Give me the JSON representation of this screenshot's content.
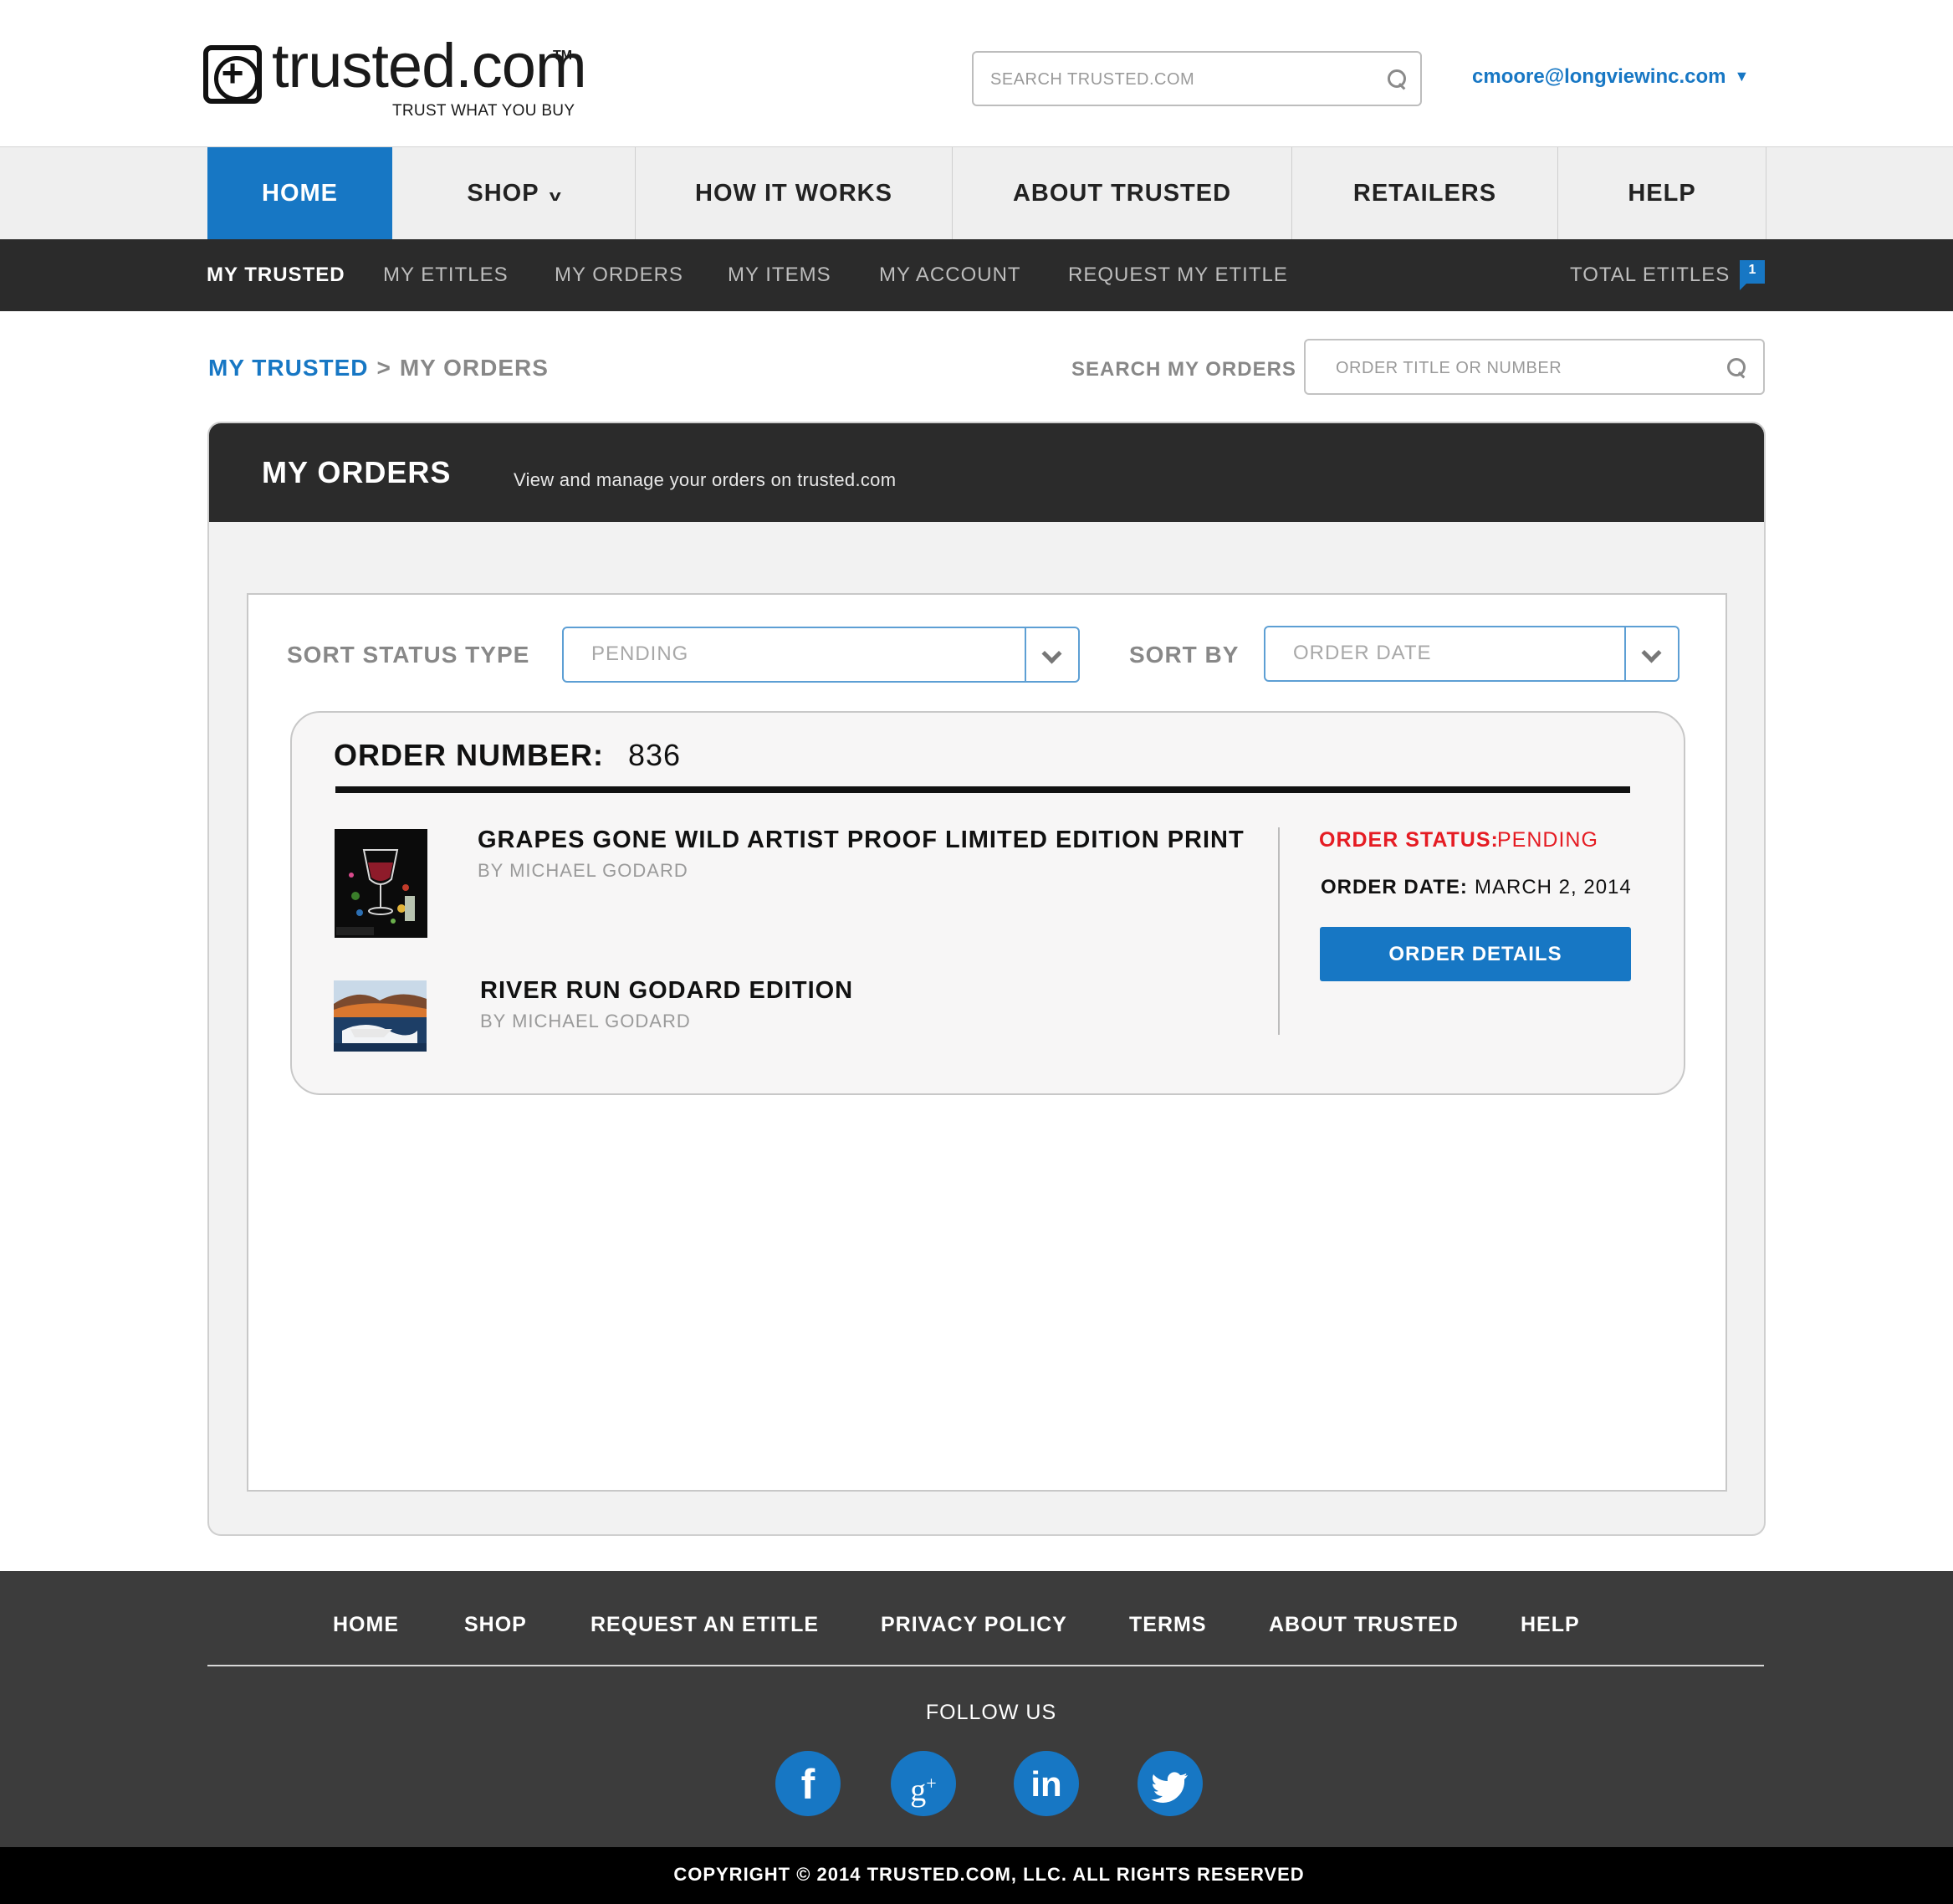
{
  "brand": {
    "name": "trusted.com",
    "trademark": "TM",
    "tagline": "TRUST WHAT YOU BUY",
    "accent_color": "#1777c4",
    "alert_color": "#e51c23"
  },
  "header": {
    "search_placeholder": "SEARCH TRUSTED.COM",
    "search_icon": "search-icon",
    "user_email": "cmoore@longviewinc.com",
    "user_chevron": "chevron-down-icon"
  },
  "main_nav": {
    "items": [
      {
        "label": "HOME",
        "active": true
      },
      {
        "label": "SHOP",
        "has_dropdown": true
      },
      {
        "label": "HOW IT WORKS"
      },
      {
        "label": "ABOUT TRUSTED"
      },
      {
        "label": "RETAILERS"
      },
      {
        "label": "HELP"
      }
    ]
  },
  "sub_nav": {
    "items": [
      {
        "label": "MY TRUSTED",
        "active": true
      },
      {
        "label": "MY ETITLES"
      },
      {
        "label": "MY ORDERS"
      },
      {
        "label": "MY ITEMS"
      },
      {
        "label": "MY ACCOUNT"
      },
      {
        "label": "REQUEST MY ETITLE"
      }
    ],
    "total_etitles_label": "TOTAL ETITLES",
    "total_etitles_count": "1"
  },
  "breadcrumb": {
    "root": "MY TRUSTED",
    "separator": ">",
    "current": "MY ORDERS"
  },
  "order_search": {
    "label": "SEARCH MY ORDERS",
    "placeholder": "ORDER TITLE OR NUMBER"
  },
  "panel": {
    "title": "MY ORDERS",
    "subtitle": "View and manage your orders on trusted.com"
  },
  "filters": {
    "status_label": "SORT STATUS TYPE",
    "status_value": "PENDING",
    "sort_label": "SORT BY",
    "sort_value": "ORDER DATE"
  },
  "order": {
    "number_label": "ORDER NUMBER:",
    "number": "836",
    "status_label": "ORDER STATUS:",
    "status": "PENDING",
    "date_label": "ORDER DATE:",
    "date": "MARCH 2, 2014",
    "details_button": "ORDER DETAILS",
    "items": [
      {
        "title": "GRAPES GONE WILD ARTIST PROOF LIMITED EDITION PRINT",
        "artist": "BY MICHAEL GODARD"
      },
      {
        "title": "RIVER RUN GODARD EDITION",
        "artist": "BY MICHAEL GODARD"
      }
    ]
  },
  "footer": {
    "links": [
      "HOME",
      "SHOP",
      "REQUEST AN ETITLE",
      "PRIVACY POLICY",
      "TERMS",
      "ABOUT TRUSTED",
      "HELP"
    ],
    "follow_us": "FOLLOW US",
    "social": [
      {
        "name": "facebook-icon",
        "glyph": "f"
      },
      {
        "name": "google-plus-icon",
        "glyph": "g+"
      },
      {
        "name": "linkedin-icon",
        "glyph": "in"
      },
      {
        "name": "twitter-icon",
        "glyph": "twitter"
      }
    ],
    "copyright": "COPYRIGHT © 2014 TRUSTED.COM, LLC. ALL RIGHTS RESERVED"
  }
}
